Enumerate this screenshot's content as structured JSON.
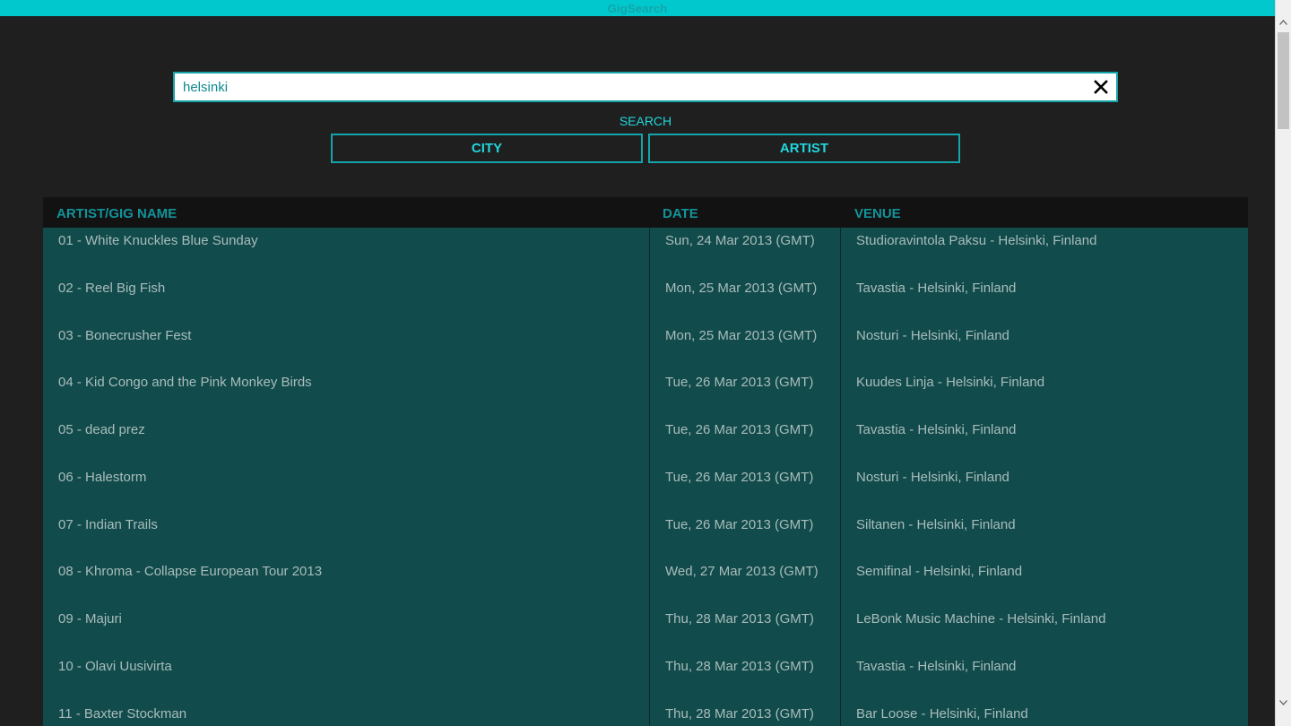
{
  "window": {
    "title": "GigSearch"
  },
  "search": {
    "value": "helsinki",
    "label": "SEARCH",
    "buttons": {
      "city": "CITY",
      "artist": "ARTIST"
    }
  },
  "table": {
    "headers": {
      "name": "ARTIST/GIG NAME",
      "date": "DATE",
      "venue": "VENUE"
    },
    "rows": [
      {
        "name": "01 - White Knuckles Blue Sunday",
        "date": "Sun, 24 Mar 2013 (GMT)",
        "venue": "Studioravintola Paksu - Helsinki, Finland"
      },
      {
        "name": "02 - Reel Big Fish",
        "date": "Mon, 25 Mar 2013 (GMT)",
        "venue": "Tavastia - Helsinki, Finland"
      },
      {
        "name": "03 - Bonecrusher Fest",
        "date": "Mon, 25 Mar 2013 (GMT)",
        "venue": "Nosturi - Helsinki, Finland"
      },
      {
        "name": "04 - Kid Congo and the Pink Monkey Birds",
        "date": "Tue, 26 Mar 2013 (GMT)",
        "venue": "Kuudes Linja - Helsinki, Finland"
      },
      {
        "name": "05 - dead prez",
        "date": "Tue, 26 Mar 2013 (GMT)",
        "venue": "Tavastia - Helsinki, Finland"
      },
      {
        "name": "06 - Halestorm",
        "date": "Tue, 26 Mar 2013 (GMT)",
        "venue": "Nosturi - Helsinki, Finland"
      },
      {
        "name": "07 - Indian Trails",
        "date": "Tue, 26 Mar 2013 (GMT)",
        "venue": "Siltanen - Helsinki, Finland"
      },
      {
        "name": "08 - Khroma - Collapse European Tour 2013",
        "date": "Wed, 27 Mar 2013 (GMT)",
        "venue": "Semifinal - Helsinki, Finland"
      },
      {
        "name": "09 - Majuri",
        "date": "Thu, 28 Mar 2013 (GMT)",
        "venue": "LeBonk Music Machine - Helsinki, Finland"
      },
      {
        "name": "10 - Olavi Uusivirta",
        "date": "Thu, 28 Mar 2013 (GMT)",
        "venue": "Tavastia - Helsinki, Finland"
      },
      {
        "name": "11 - Baxter Stockman",
        "date": "Thu, 28 Mar 2013 (GMT)",
        "venue": "Bar Loose - Helsinki, Finland"
      }
    ]
  },
  "icons": {
    "clear": "close-icon",
    "scroll_up": "chevron-up-icon",
    "scroll_down": "chevron-down-icon"
  },
  "colors": {
    "accent": "#00c8cc",
    "background": "#1f1f1f",
    "table_bg": "#124b4b",
    "header_bg": "#121212"
  }
}
